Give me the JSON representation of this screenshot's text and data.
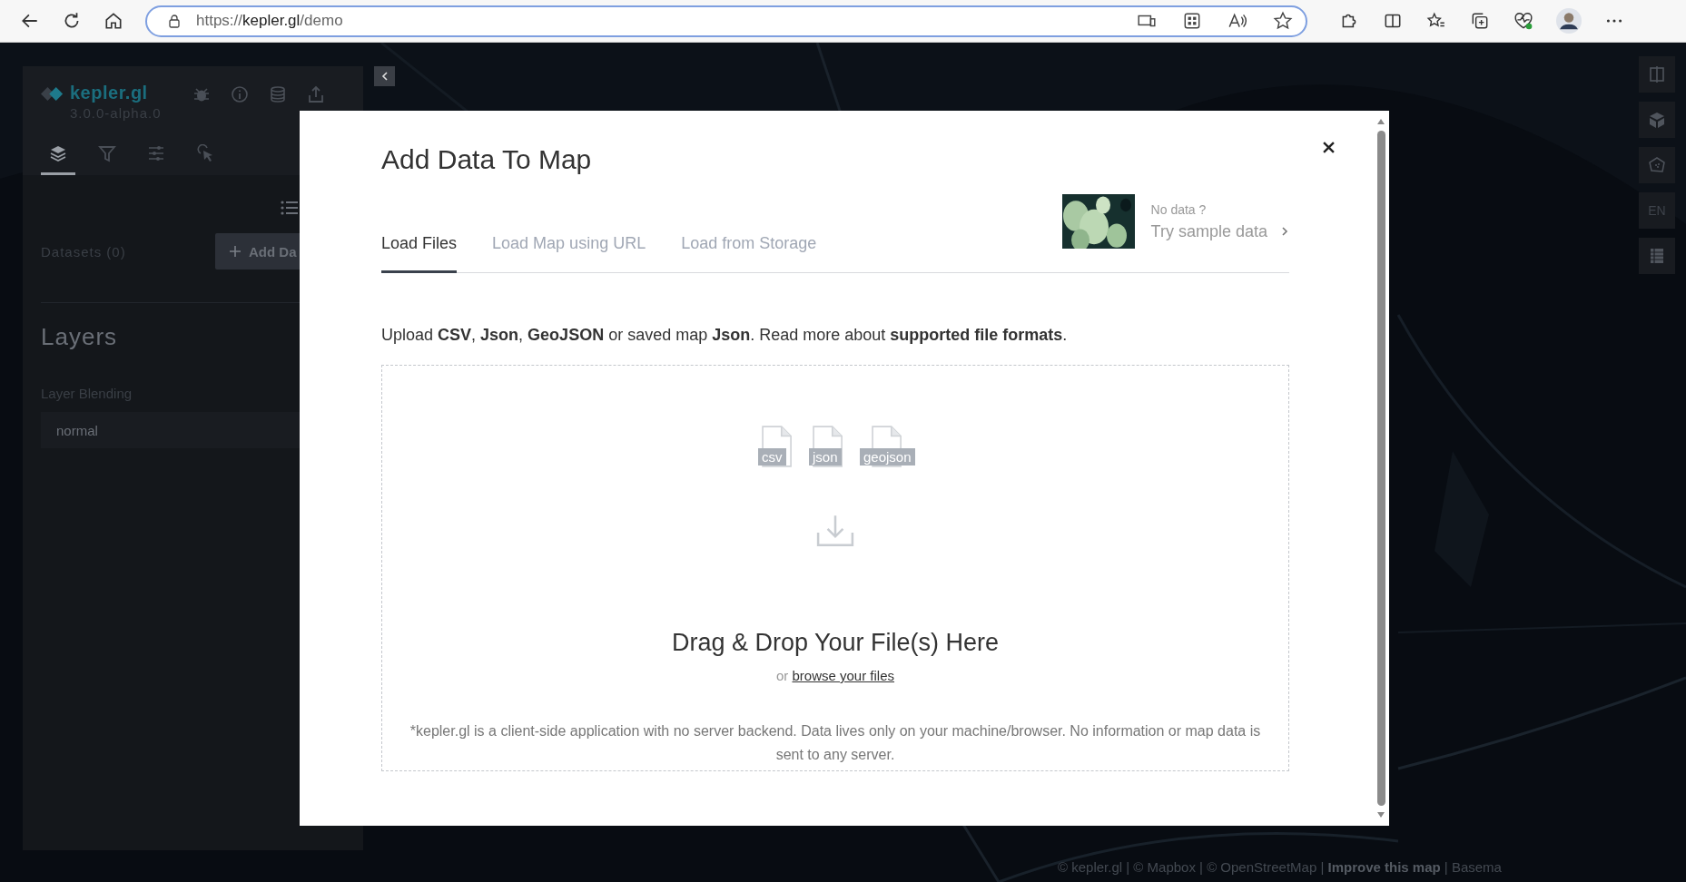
{
  "browser": {
    "url_prefix": "https://",
    "url_host": "kepler.gl",
    "url_path": "/demo"
  },
  "sidebar": {
    "logo": "kepler.gl",
    "version": "3.0.0-alpha.0",
    "panel_tabs": [
      {
        "kind": "layers",
        "selected": true
      },
      {
        "kind": "filters",
        "selected": false
      },
      {
        "kind": "interactions",
        "selected": false
      },
      {
        "kind": "tooltip",
        "selected": false
      }
    ],
    "datasets_label": "Datasets (0)",
    "add_data_button": "Add Da",
    "section_title": "Layers",
    "blending_label": "Layer Blending",
    "blending_value": "normal"
  },
  "map_controls": [
    {
      "kind": "split"
    },
    {
      "kind": "cube"
    },
    {
      "kind": "draw"
    },
    {
      "kind": "locale",
      "label": "EN"
    },
    {
      "kind": "legend"
    }
  ],
  "attribution": {
    "text": "© kepler.gl | © Mapbox | © OpenStreetMap | ",
    "link": "Improve this map",
    "rest": "| Basema"
  },
  "modal": {
    "title": "Add Data To Map",
    "tabs": [
      {
        "label": "Load Files",
        "selected": true
      },
      {
        "label": "Load Map using URL",
        "selected": false
      },
      {
        "label": "Load from Storage",
        "selected": false
      }
    ],
    "sample": {
      "kind": "picture",
      "hint": "No data ?",
      "link": "Try sample data"
    },
    "intro": {
      "text": "Upload **CSV**, **Json**, **GeoJSON** or saved map **Json**. Read more about ",
      "link": "supported file formats",
      "end": "."
    },
    "file_types": [
      "csv",
      "json",
      "geojson"
    ],
    "drop_title": "Drag & Drop Your File(s) Here",
    "browse_prefix": "or",
    "browse_link": "browse your files",
    "disclaimer": "*kepler.gl is a client-side application with no server backend. Data lives only on your machine/browser. No information or map data is sent to any server."
  }
}
